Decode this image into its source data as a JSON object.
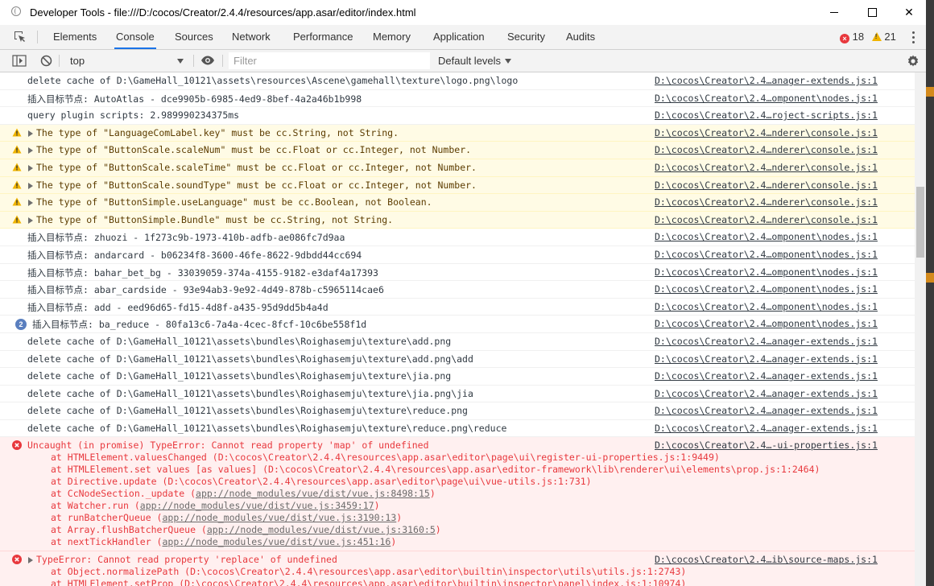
{
  "window": {
    "title": "Developer Tools - file:///D:/cocos/Creator/2.4.4/resources/app.asar/editor/index.html",
    "minimize_icon": "minimize-icon",
    "maximize_icon": "maximize-icon",
    "close_label": "✕"
  },
  "tabs": [
    "Elements",
    "Console",
    "Sources",
    "Network",
    "Performance",
    "Memory",
    "Application",
    "Security",
    "Audits"
  ],
  "active_tab": "Console",
  "counts": {
    "errors": "18",
    "warnings": "21"
  },
  "toolbar": {
    "context": "top",
    "filter_placeholder": "Filter",
    "levels": "Default levels"
  },
  "messages": [
    {
      "type": "log",
      "text": "delete cache of D:\\GameHall_10121\\assets\\resources\\Ascene\\gamehall\\texture\\logo.png\\logo",
      "source": "D:\\cocos\\Creator\\2.4…anager-extends.js:1"
    },
    {
      "type": "log",
      "text": "插入目标节点: AutoAtlas - dce9905b-6985-4ed9-8bef-4a2a46b1b998",
      "source": "D:\\cocos\\Creator\\2.4…omponent\\nodes.js:1"
    },
    {
      "type": "log",
      "text": "query plugin scripts: 2.989990234375ms",
      "source": "D:\\cocos\\Creator\\2.4…roject-scripts.js:1"
    },
    {
      "type": "warning",
      "text": "The type of \"LanguageComLabel.key\" must be cc.String, not String.",
      "source": "D:\\cocos\\Creator\\2.4…nderer\\console.js:1"
    },
    {
      "type": "warning",
      "text": "The type of \"ButtonScale.scaleNum\" must be cc.Float or cc.Integer, not Number.",
      "source": "D:\\cocos\\Creator\\2.4…nderer\\console.js:1"
    },
    {
      "type": "warning",
      "text": "The type of \"ButtonScale.scaleTime\" must be cc.Float or cc.Integer, not Number.",
      "source": "D:\\cocos\\Creator\\2.4…nderer\\console.js:1"
    },
    {
      "type": "warning",
      "text": "The type of \"ButtonScale.soundType\" must be cc.Float or cc.Integer, not Number.",
      "source": "D:\\cocos\\Creator\\2.4…nderer\\console.js:1"
    },
    {
      "type": "warning",
      "text": "The type of \"ButtonSimple.useLanguage\" must be cc.Boolean, not Boolean.",
      "source": "D:\\cocos\\Creator\\2.4…nderer\\console.js:1"
    },
    {
      "type": "warning",
      "text": "The type of \"ButtonSimple.Bundle\" must be cc.String, not String.",
      "source": "D:\\cocos\\Creator\\2.4…nderer\\console.js:1"
    },
    {
      "type": "log",
      "text": "插入目标节点: zhuozi - 1f273c9b-1973-410b-adfb-ae086fc7d9aa",
      "source": "D:\\cocos\\Creator\\2.4…omponent\\nodes.js:1"
    },
    {
      "type": "log",
      "text": "插入目标节点: andarcard - b06234f8-3600-46fe-8622-9dbdd44cc694",
      "source": "D:\\cocos\\Creator\\2.4…omponent\\nodes.js:1"
    },
    {
      "type": "log",
      "text": "插入目标节点: bahar_bet_bg - 33039059-374a-4155-9182-e3daf4a17393",
      "source": "D:\\cocos\\Creator\\2.4…omponent\\nodes.js:1"
    },
    {
      "type": "log",
      "text": "插入目标节点: abar_cardside - 93e94ab3-9e92-4d49-878b-c5965114cae6",
      "source": "D:\\cocos\\Creator\\2.4…omponent\\nodes.js:1"
    },
    {
      "type": "log",
      "text": "插入目标节点: add - eed96d65-fd15-4d8f-a435-95d9dd5b4a4d",
      "source": "D:\\cocos\\Creator\\2.4…omponent\\nodes.js:1"
    },
    {
      "type": "log",
      "repeat": "2",
      "text": "插入目标节点: ba_reduce - 80fa13c6-7a4a-4cec-8fcf-10c6be558f1d",
      "source": "D:\\cocos\\Creator\\2.4…omponent\\nodes.js:1"
    },
    {
      "type": "log",
      "text": "delete cache of D:\\GameHall_10121\\assets\\bundles\\Roighasemju\\texture\\add.png",
      "source": "D:\\cocos\\Creator\\2.4…anager-extends.js:1"
    },
    {
      "type": "log",
      "text": "delete cache of D:\\GameHall_10121\\assets\\bundles\\Roighasemju\\texture\\add.png\\add",
      "source": "D:\\cocos\\Creator\\2.4…anager-extends.js:1"
    },
    {
      "type": "log",
      "text": "delete cache of D:\\GameHall_10121\\assets\\bundles\\Roighasemju\\texture\\jia.png",
      "source": "D:\\cocos\\Creator\\2.4…anager-extends.js:1"
    },
    {
      "type": "log",
      "text": "delete cache of D:\\GameHall_10121\\assets\\bundles\\Roighasemju\\texture\\jia.png\\jia",
      "source": "D:\\cocos\\Creator\\2.4…anager-extends.js:1"
    },
    {
      "type": "log",
      "text": "delete cache of D:\\GameHall_10121\\assets\\bundles\\Roighasemju\\texture\\reduce.png",
      "source": "D:\\cocos\\Creator\\2.4…anager-extends.js:1"
    },
    {
      "type": "log",
      "text": "delete cache of D:\\GameHall_10121\\assets\\bundles\\Roighasemju\\texture\\reduce.png\\reduce",
      "source": "D:\\cocos\\Creator\\2.4…anager-extends.js:1"
    }
  ],
  "error1": {
    "text": "Uncaught (in promise) TypeError: Cannot read property 'map' of undefined",
    "source": "D:\\cocos\\Creator\\2.4…-ui-properties.js:1",
    "stack": [
      {
        "pre": "at HTMLElement.valuesChanged (D:\\cocos\\Creator\\2.4.4\\resources\\app.asar\\editor\\page\\ui\\register-ui-properties.js:1:9449)",
        "link": "",
        "post": ""
      },
      {
        "pre": "at HTMLElement.set values [as values] (D:\\cocos\\Creator\\2.4.4\\resources\\app.asar\\editor-framework\\lib\\renderer\\ui\\elements\\prop.js:1:2464)",
        "link": "",
        "post": ""
      },
      {
        "pre": "at Directive.update (D:\\cocos\\Creator\\2.4.4\\resources\\app.asar\\editor\\page\\ui\\vue-utils.js:1:731)",
        "link": "",
        "post": ""
      },
      {
        "pre": "at CcNodeSection._update (",
        "link": "app://node_modules/vue/dist/vue.js:8498:15",
        "post": ")"
      },
      {
        "pre": "at Watcher.run (",
        "link": "app://node_modules/vue/dist/vue.js:3459:17",
        "post": ")"
      },
      {
        "pre": "at runBatcherQueue (",
        "link": "app://node_modules/vue/dist/vue.js:3190:13",
        "post": ")"
      },
      {
        "pre": "at Array.flushBatcherQueue (",
        "link": "app://node_modules/vue/dist/vue.js:3160:5",
        "post": ")"
      },
      {
        "pre": "at nextTickHandler (",
        "link": "app://node_modules/vue/dist/vue.js:451:16",
        "post": ")"
      }
    ]
  },
  "error2": {
    "text": "TypeError: Cannot read property 'replace' of undefined",
    "source": "D:\\cocos\\Creator\\2.4…ib\\source-maps.js:1",
    "stack": [
      {
        "pre": "at Object.normalizePath (D:\\cocos\\Creator\\2.4.4\\resources\\app.asar\\editor\\builtin\\inspector\\utils\\utils.js:1:2743)",
        "link": "",
        "post": ""
      },
      {
        "pre": "at HTMLElement.setProp (D:\\cocos\\Creator\\2.4.4\\resources\\app.asar\\editor\\builtin\\inspector\\panel\\index.js:1:10974)",
        "link": "",
        "post": ""
      }
    ]
  },
  "colors": {
    "accent": "#1a73e8",
    "error": "#e8383d",
    "warning_bg": "#fffbe5",
    "error_bg": "#fff0f0"
  }
}
